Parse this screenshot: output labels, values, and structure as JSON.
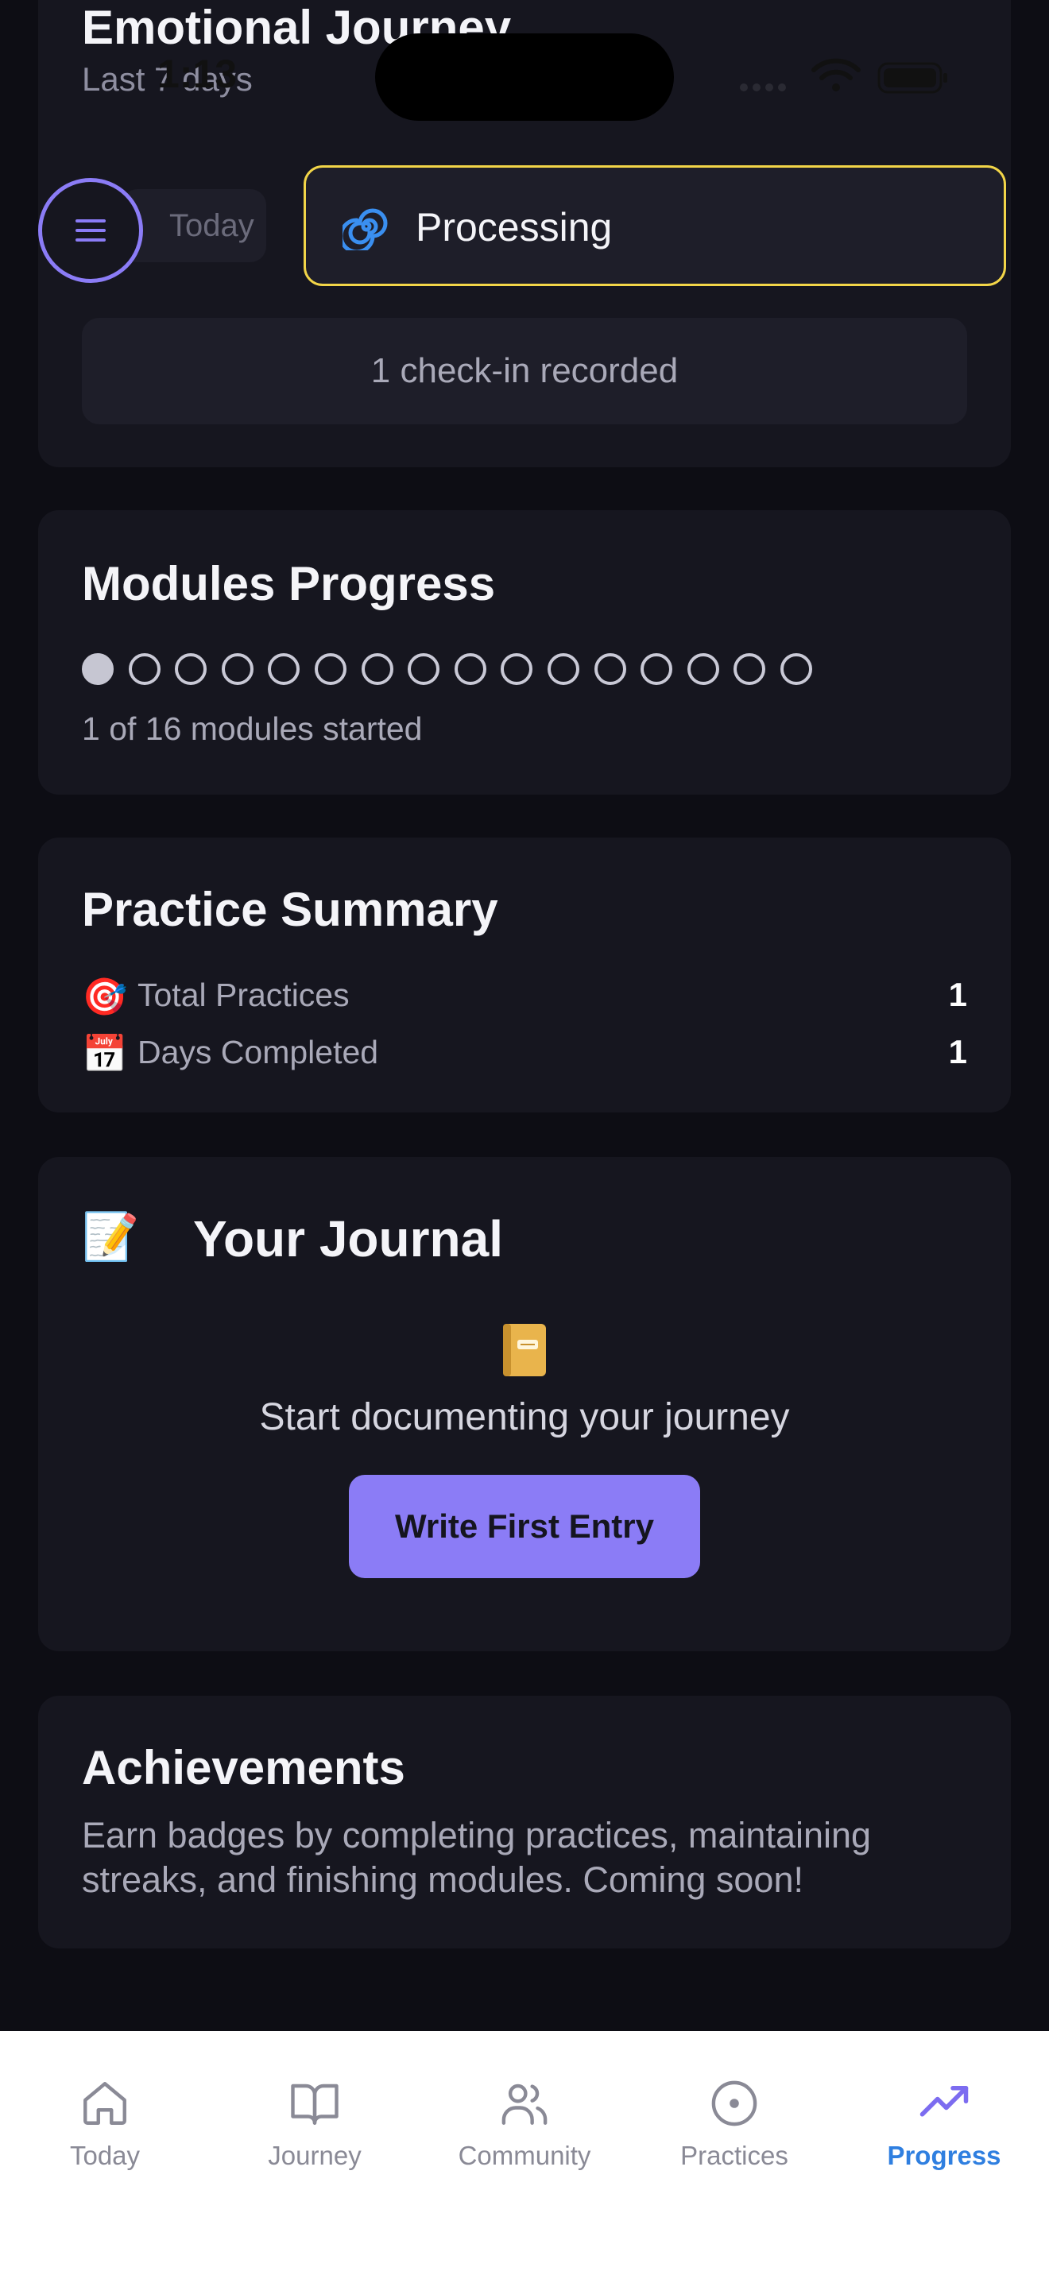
{
  "status_bar": {
    "time": "1:13"
  },
  "emotional_journey": {
    "title": "Emotional Journey",
    "subtitle": "Last 7 days",
    "today_chip": "Today",
    "mood_label": "Processing",
    "mood_icon": "spiral-icon",
    "checkin_text": "1 check-in recorded",
    "accent_color": "#f2d548"
  },
  "modules": {
    "title": "Modules Progress",
    "total": 16,
    "started": 1,
    "caption": "1 of 16 modules started"
  },
  "practice_summary": {
    "title": "Practice Summary",
    "stats": [
      {
        "icon": "🎯",
        "label": "Total Practices",
        "value": "1"
      },
      {
        "icon": "📅",
        "label": "Days Completed",
        "value": "1"
      }
    ]
  },
  "journal": {
    "title_icon": "📝",
    "title": "Your Journal",
    "empty_icon": "book-icon",
    "empty_text": "Start documenting your journey",
    "button_label": "Write First Entry",
    "button_color": "#8b7cf6"
  },
  "achievements": {
    "title": "Achievements",
    "text": "Earn badges by completing practices, maintaining streaks, and finishing modules. Coming soon!"
  },
  "tabbar": {
    "tabs": [
      {
        "label": "Today",
        "icon": "home-icon",
        "active": false
      },
      {
        "label": "Journey",
        "icon": "book-open-icon",
        "active": false
      },
      {
        "label": "Community",
        "icon": "users-icon",
        "active": false
      },
      {
        "label": "Practices",
        "icon": "target-icon",
        "active": false
      },
      {
        "label": "Progress",
        "icon": "trending-up-icon",
        "active": true
      }
    ],
    "active_color": "#2f7fe0",
    "active_icon_color": "#7c6cf0"
  }
}
